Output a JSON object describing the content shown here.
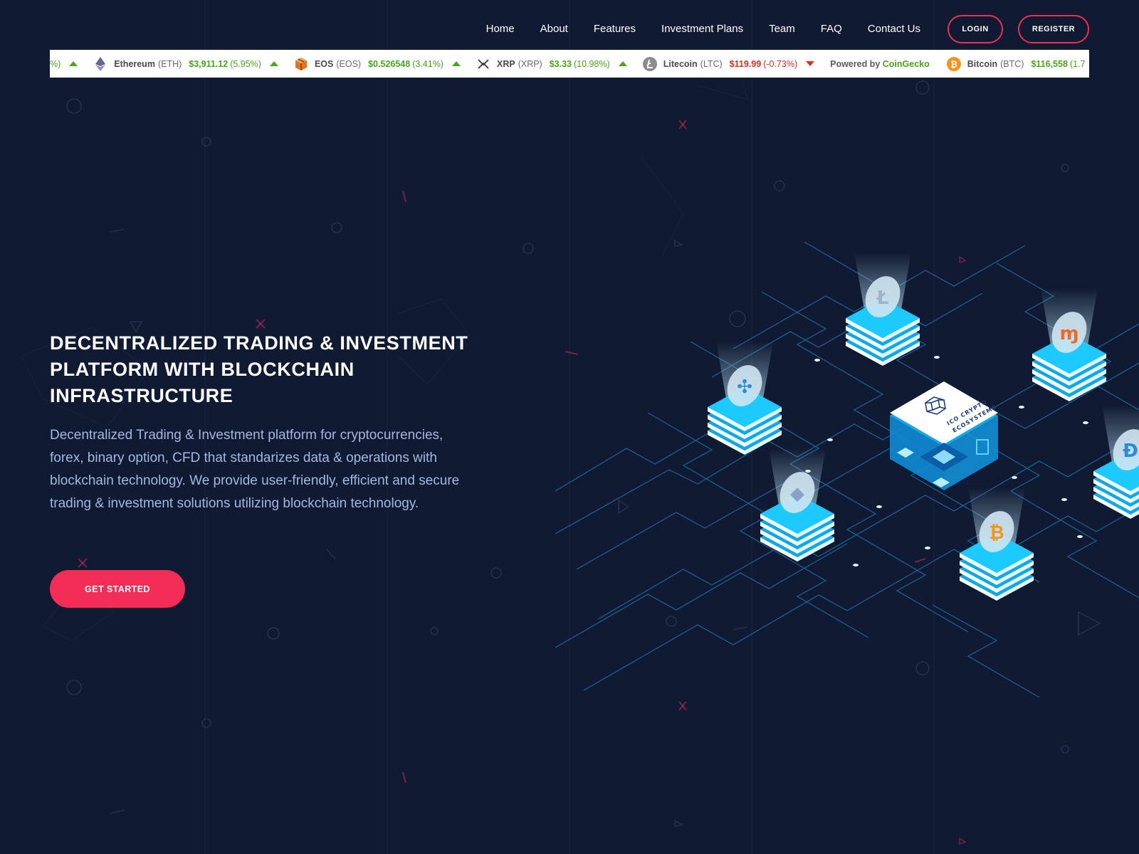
{
  "nav": {
    "links": [
      "Home",
      "About",
      "Features",
      "Investment Plans",
      "Team",
      "FAQ",
      "Contact Us"
    ],
    "login_label": "LOGIN",
    "register_label": "REGISTER"
  },
  "ticker": {
    "lead_fragment": "%)",
    "items": [
      {
        "name": "Ethereum",
        "symbol": "(ETH)",
        "price": "$3,911.12",
        "change": "(5.95%)",
        "direction": "up",
        "icon": "ethereum-icon"
      },
      {
        "name": "EOS",
        "symbol": "(EOS)",
        "price": "$0.526548",
        "change": "(3.41%)",
        "direction": "up",
        "icon": "eos-icon"
      },
      {
        "name": "XRP",
        "symbol": "(XRP)",
        "price": "$3.33",
        "change": "(10.98%)",
        "direction": "up",
        "icon": "xrp-icon"
      },
      {
        "name": "Litecoin",
        "symbol": "(LTC)",
        "price": "$119.99",
        "change": "(-0.73%)",
        "direction": "down",
        "icon": "litecoin-icon"
      }
    ],
    "powered_prefix": "Powered by",
    "powered_brand": "CoinGecko",
    "tail": {
      "name": "Bitcoin",
      "symbol": "(BTC)",
      "price": "$116,558",
      "change": "(1.7",
      "icon": "bitcoin-icon"
    }
  },
  "hero": {
    "title": "DECENTRALIZED TRADING & INVESTMENT PLATFORM WITH BLOCKCHAIN INFRASTRUCTURE",
    "description": "Decentralized Trading & Investment platform for cryptocurrencies, forex, binary option, CFD that standarizes data & operations with blockchain technology. We provide user-friendly, efficient and secure trading & investment solutions utilizing blockchain technology.",
    "cta_label": "GET STARTED"
  },
  "illustration": {
    "center_label_1": "ICO CRYPTO",
    "center_label_2": "ECOSYSTEMS"
  },
  "colors": {
    "background": "#111a33",
    "accent": "#f42d56",
    "up": "#4aa51f",
    "down": "#d8321f",
    "cyan": "#1bc7ff"
  }
}
